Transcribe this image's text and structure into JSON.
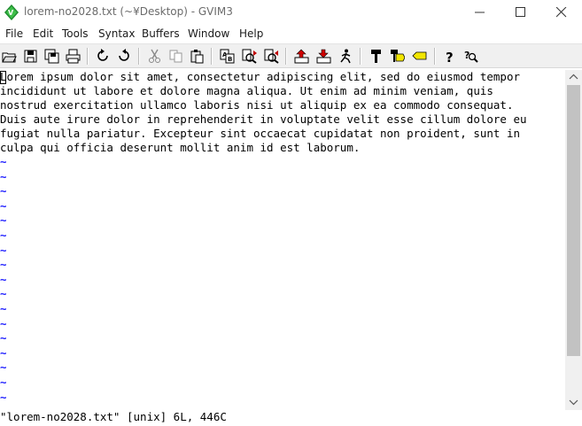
{
  "window": {
    "title": "lorem-no2028.txt (~¥Desktop) - GVIM3"
  },
  "menu": [
    "File",
    "Edit",
    "Tools",
    "Syntax",
    "Buffers",
    "Window",
    "Help"
  ],
  "toolbar": {
    "icons": [
      "open-icon",
      "save-icon",
      "save-all-icon",
      "print-icon",
      "undo-icon",
      "redo-icon",
      "cut-icon",
      "copy-icon",
      "paste-icon",
      "replace-icon",
      "find-next-icon",
      "find-prev-icon",
      "load-session-icon",
      "save-session-icon",
      "run-script-icon",
      "make-icon",
      "build-tags-icon",
      "jump-tag-icon",
      "help-icon",
      "find-help-icon"
    ]
  },
  "editor": {
    "lines": [
      "Lorem ipsum dolor sit amet, consectetur adipiscing elit, sed do eiusmod tempor",
      "incididunt ut labore et dolore magna aliqua. Ut enim ad minim veniam, quis",
      "nostrud exercitation ullamco laboris nisi ut aliquip ex ea commodo consequat.",
      "Duis aute irure dolor in reprehenderit in voluptate velit esse cillum dolore eu",
      "fugiat nulla pariatur. Excepteur sint occaecat cupidatat non proident, sunt in",
      "culpa qui officia deserunt mollit anim id est laborum."
    ],
    "filler": "~",
    "filler_count": 17
  },
  "status": {
    "message": "\"lorem-no2028.txt\" [unix] 6L, 446C"
  },
  "colors": {
    "filler_blue": "#2020ff",
    "toolbar_bg": "#f0f0f0",
    "thumb": "#c2c2c2"
  }
}
